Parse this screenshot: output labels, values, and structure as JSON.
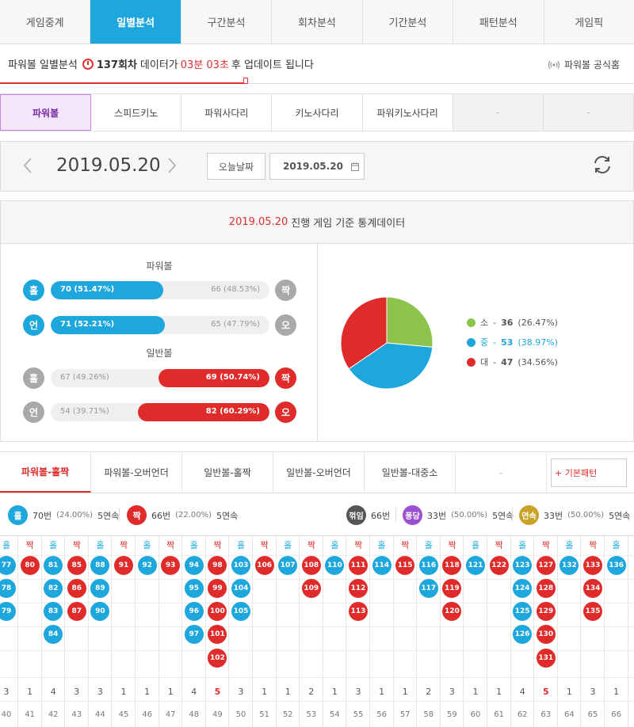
{
  "top_tabs": [
    "게임중계",
    "일별분석",
    "구간분석",
    "회차분석",
    "기간분석",
    "패턴분석",
    "게임픽"
  ],
  "info": {
    "prefix": "파워볼 일별분석",
    "round": "137회차",
    "mid": "데이터가",
    "time": "03분 03초",
    "suffix": "후 업데이트 됩니다",
    "official_link": "파워볼 공식홈",
    "progress": 0.39
  },
  "game_tabs": [
    "파워볼",
    "스피드키노",
    "파워사다리",
    "키노사다리",
    "파워키노사다리",
    "-",
    "-"
  ],
  "date_nav": {
    "date": "2019.05.20",
    "today_label": "오늘날짜",
    "date_value": "2019.05.20"
  },
  "stats": {
    "header_date": "2019.05.20",
    "header_text": "진행 게임 기준 통계데이터",
    "powerball_title": "파워볼",
    "normal_title": "일반볼",
    "rows": [
      {
        "left_badge": "홀",
        "right_badge": "짝",
        "left_val": "70 (51.47%)",
        "right_val": "66 (48.53%)",
        "left_pct": 51.47,
        "winner": "left"
      },
      {
        "left_badge": "언",
        "right_badge": "오",
        "left_val": "71 (52.21%)",
        "right_val": "65 (47.79%)",
        "left_pct": 52.21,
        "winner": "left"
      },
      {
        "left_badge": "홀",
        "right_badge": "짝",
        "left_val": "67 (49.26%)",
        "right_val": "69 (50.74%)",
        "left_pct": 49.26,
        "winner": "right"
      },
      {
        "left_badge": "언",
        "right_badge": "오",
        "left_val": "54 (39.71%)",
        "right_val": "82 (60.29%)",
        "left_pct": 39.71,
        "winner": "right"
      }
    ],
    "pie": [
      {
        "label": "소",
        "count": "36",
        "pct": "(26.47%)",
        "value": 26.47,
        "color": "#8dc54c"
      },
      {
        "label": "중",
        "count": "53",
        "pct": "(38.97%)",
        "value": 38.97,
        "color": "#1ea7dc"
      },
      {
        "label": "대",
        "count": "47",
        "pct": "(34.56%)",
        "value": 34.56,
        "color": "#e02b2b"
      }
    ]
  },
  "pattern_tabs": [
    "파워볼-홀짝",
    "파워볼-오버언더",
    "일반볼-홀짝",
    "일반볼-오버언더",
    "일반볼-대중소",
    "-"
  ],
  "basic_pattern": "+ 기본패턴",
  "summary": {
    "odd_badge": "홀",
    "odd_text": "70번",
    "odd_pct": "(24.00%)",
    "odd_streak": "5연속",
    "even_badge": "짝",
    "even_text": "66번",
    "even_pct": "(22.00%)",
    "even_streak": "5연속",
    "break_badge": "꺾임",
    "break_text": "66번",
    "pong_badge": "퐁당",
    "pong_text": "33번",
    "pong_pct": "(50.00%)",
    "pong_streak": "5연속",
    "cont_badge": "연속",
    "cont_text": "33번",
    "cont_pct": "(50.00%)",
    "cont_streak": "5연속"
  },
  "grid": [
    {
      "type": "홀",
      "rounds": [
        "77",
        "78",
        "79"
      ],
      "label": "40"
    },
    {
      "type": "짝",
      "rounds": [
        "80"
      ],
      "label": "41"
    },
    {
      "type": "홀",
      "rounds": [
        "81",
        "82",
        "83",
        "84"
      ],
      "label": "42"
    },
    {
      "type": "짝",
      "rounds": [
        "85",
        "86",
        "87"
      ],
      "label": "43"
    },
    {
      "type": "홀",
      "rounds": [
        "88",
        "89",
        "90"
      ],
      "label": "44"
    },
    {
      "type": "짝",
      "rounds": [
        "91"
      ],
      "label": "45"
    },
    {
      "type": "홀",
      "rounds": [
        "92"
      ],
      "label": "46"
    },
    {
      "type": "짝",
      "rounds": [
        "93"
      ],
      "label": "47"
    },
    {
      "type": "홀",
      "rounds": [
        "94",
        "95",
        "96",
        "97"
      ],
      "label": "48"
    },
    {
      "type": "짝",
      "rounds": [
        "98",
        "99",
        "100",
        "101",
        "102"
      ],
      "label": "49"
    },
    {
      "type": "홀",
      "rounds": [
        "103",
        "104",
        "105"
      ],
      "label": "50"
    },
    {
      "type": "짝",
      "rounds": [
        "106"
      ],
      "label": "51"
    },
    {
      "type": "홀",
      "rounds": [
        "107"
      ],
      "label": "52"
    },
    {
      "type": "짝",
      "rounds": [
        "108",
        "109"
      ],
      "label": "53"
    },
    {
      "type": "홀",
      "rounds": [
        "110"
      ],
      "label": "54"
    },
    {
      "type": "짝",
      "rounds": [
        "111",
        "112",
        "113"
      ],
      "label": "55"
    },
    {
      "type": "홀",
      "rounds": [
        "114"
      ],
      "label": "56"
    },
    {
      "type": "짝",
      "rounds": [
        "115"
      ],
      "label": "57"
    },
    {
      "type": "홀",
      "rounds": [
        "116",
        "117"
      ],
      "label": "58"
    },
    {
      "type": "짝",
      "rounds": [
        "118",
        "119",
        "120"
      ],
      "label": "59"
    },
    {
      "type": "홀",
      "rounds": [
        "121"
      ],
      "label": "60"
    },
    {
      "type": "짝",
      "rounds": [
        "122"
      ],
      "label": "61"
    },
    {
      "type": "홀",
      "rounds": [
        "123",
        "124",
        "125",
        "126"
      ],
      "label": "62"
    },
    {
      "type": "짝",
      "rounds": [
        "127",
        "128",
        "129",
        "130",
        "131"
      ],
      "label": "63"
    },
    {
      "type": "홀",
      "rounds": [
        "132"
      ],
      "label": "64"
    },
    {
      "type": "짝",
      "rounds": [
        "133",
        "134",
        "135"
      ],
      "label": "65"
    },
    {
      "type": "홀",
      "rounds": [
        "136"
      ],
      "label": "66"
    }
  ]
}
